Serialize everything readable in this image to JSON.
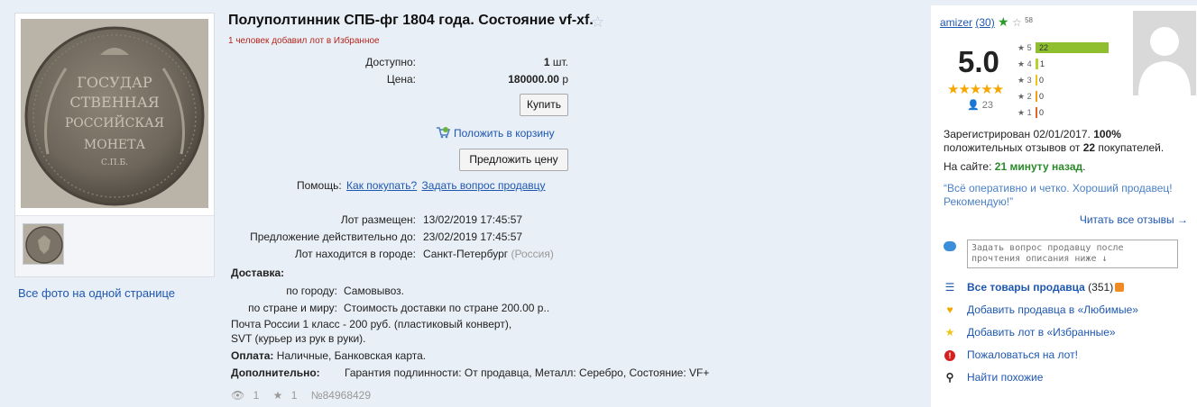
{
  "lot": {
    "title": "Полуполтинник СПБ-фг 1804 года. Состояние vf-xf.",
    "fav_note": "1 человек добавил лот в Избранное",
    "available_label": "Доступно:",
    "available_value": "1",
    "available_unit": "шт.",
    "price_label": "Цена:",
    "price_value": "180000.00",
    "price_currency": "р",
    "buy_button": "Купить",
    "cart_link": "Положить в корзину",
    "offer_button": "Предложить цену",
    "help_label": "Помощь:",
    "help_link1": "Как покупать?",
    "help_link2": "Задать вопрос продавцу",
    "placed_label": "Лот размещен:",
    "placed_value": "13/02/2019 17:45:57",
    "valid_label": "Предложение действительно до:",
    "valid_value": "23/02/2019 17:45:57",
    "city_label": "Лот находится в городе:",
    "city_value": "Санкт-Петербург",
    "city_country": "(Россия)",
    "delivery_label": "Доставка:",
    "city_delivery_label": "по городу:",
    "city_delivery_value": "Самовывоз.",
    "world_delivery_label": "по стране и миру:",
    "world_delivery_value": "Стоимость доставки по стране 200.00 р..",
    "post_line1": "Почта России 1 класс - 200 руб. (пластиковый конверт),",
    "post_line2": "SVT (курьер из рук в руки).",
    "payment_label": "Оплата:",
    "payment_value": "Наличные, Банковская карта.",
    "extra_label": "Дополнительно:",
    "extra_value": "Гарантия подлинности: От продавца, Металл: Серебро, Состояние: VF+",
    "views": "1",
    "stars": "1",
    "lot_number": "№84968429"
  },
  "gallery": {
    "all_photos_link": "Все фото на одной странице",
    "coin_text": [
      "ГОСУДАР",
      "СТВЕННАЯ",
      "РОССИЙСКАЯ",
      "МОНЕТА",
      "С.П.Б."
    ]
  },
  "seller": {
    "name": "amizer",
    "feedback_count": "(30)",
    "badge_number": "58",
    "rating": "5.0",
    "rating_stars": "★★★★★",
    "rating_votes": "23",
    "bars": [
      {
        "label": "5",
        "count": "22",
        "fraction": 0.96,
        "color": "#8fbf2f"
      },
      {
        "label": "4",
        "count": "1",
        "fraction": 0.04,
        "color": "#b7d12f"
      },
      {
        "label": "3",
        "count": "0",
        "fraction": 0,
        "color": "#f0c419"
      },
      {
        "label": "2",
        "count": "0",
        "fraction": 0,
        "color": "#f0a019"
      },
      {
        "label": "1",
        "count": "0",
        "fraction": 0,
        "color": "#e8632a"
      }
    ],
    "registered_prefix": "Зарегистрирован 02/01/2017.",
    "positive_pct": "100%",
    "positive_mid": "положительных отзывов от",
    "positive_count": "22",
    "positive_suffix": "покупателей.",
    "online_prefix": "На сайте:",
    "online_value": "21 минуту назад",
    "review_text": "“Всё оперативно и четко. Хороший продавец! Рекомендую!”",
    "read_all": "Читать все отзывы →",
    "ask_placeholder": "Задать вопрос продавцу после прочтения описания ниже ↓",
    "all_goods": "Все товары продавца",
    "all_goods_count": "(351)",
    "add_fav_seller": "Добавить продавца в «Любимые»",
    "add_fav_lot": "Добавить лот в «Избранные»",
    "complain": "Пожаловаться на лот!",
    "find_similar": "Найти похожие"
  },
  "colors": {
    "link": "#1e57b0",
    "star_orange": "#f5a700",
    "online_green": "#2a8a2a",
    "fav_note_red": "#b3261e"
  }
}
